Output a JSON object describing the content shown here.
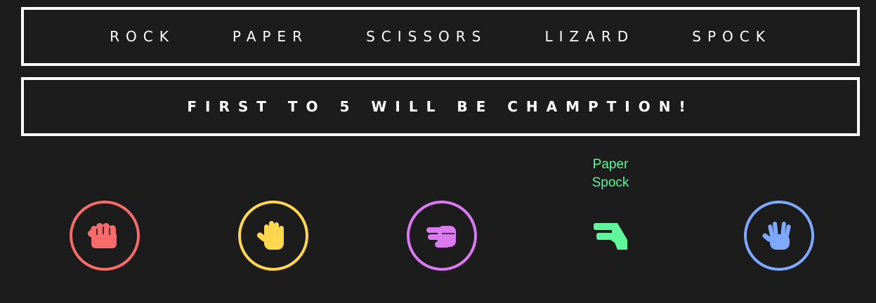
{
  "nav": {
    "items": [
      {
        "label": "ROCK"
      },
      {
        "label": "PAPER"
      },
      {
        "label": "SCISSORS"
      },
      {
        "label": "LIZARD"
      },
      {
        "label": "SPOCK"
      }
    ]
  },
  "banner": {
    "text": "FIRST TO 5 WILL BE CHAMPTION!"
  },
  "picks": {
    "player": "Paper",
    "computer": "Spock",
    "color": "#5ff59a"
  },
  "choices": [
    {
      "name": "rock",
      "icon": "rock-hand-icon",
      "color": "#f86b6b",
      "selected": false
    },
    {
      "name": "paper",
      "icon": "paper-hand-icon",
      "color": "#ffd84f",
      "selected": false
    },
    {
      "name": "scissors",
      "icon": "scissors-hand-icon",
      "color": "#db79f0",
      "selected": false
    },
    {
      "name": "lizard",
      "icon": "lizard-hand-icon",
      "color": "#5ff59a",
      "selected": true
    },
    {
      "name": "spock",
      "icon": "spock-hand-icon",
      "color": "#7fa9ff",
      "selected": false
    }
  ]
}
